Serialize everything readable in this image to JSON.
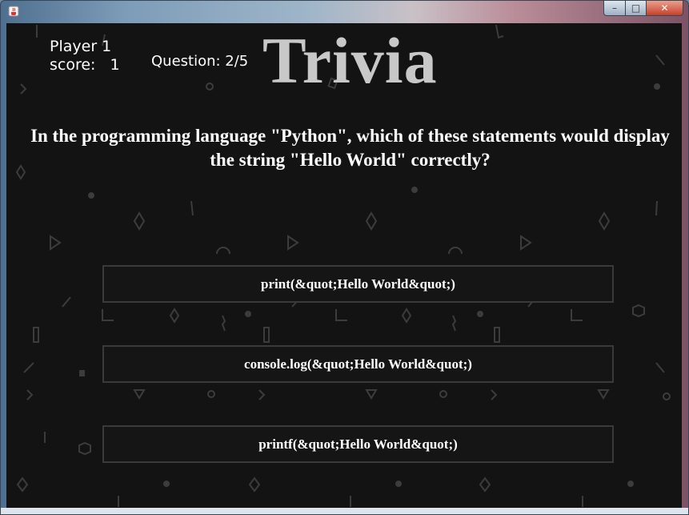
{
  "window": {
    "app_icon": "java-cup-icon",
    "controls": {
      "minimize": "–",
      "maximize": "□",
      "close": "✕"
    }
  },
  "header": {
    "player_label": "Player 1",
    "score_label": "score:",
    "score_value": "1",
    "question_counter": "Question: 2/5",
    "title": "Trivia"
  },
  "question": {
    "text": "In the programming language \"Python\", which of these statements would display the string \"Hello World\" correctly?"
  },
  "answers": [
    {
      "label": "print(&quot;Hello World&quot;)"
    },
    {
      "label": "console.log(&quot;Hello World&quot;)"
    },
    {
      "label": "printf(&quot;Hello World&quot;)"
    }
  ],
  "colors": {
    "background": "#131313",
    "text": "#ffffff",
    "title": "#c8c8c8",
    "button_border": "#3a3a3a",
    "pattern": "#3c3c3c"
  }
}
